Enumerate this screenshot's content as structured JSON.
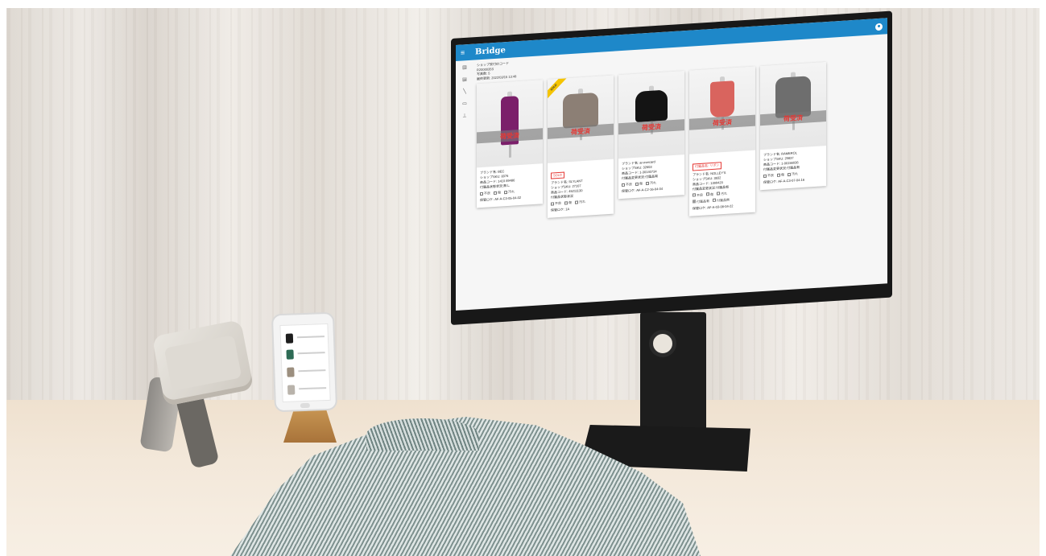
{
  "app": {
    "title": "Bridge",
    "header_color": "#1e88c9",
    "nav_icons": [
      "chart-icon",
      "store-icon",
      "tag-icon",
      "truck-icon",
      "pin-icon"
    ]
  },
  "info": {
    "line1": "ショップ受付IDコード",
    "line2": "R2000035S",
    "line3": "写真数: 5",
    "line4": "最終更新: 2022/03/15 13:48"
  },
  "cards": [
    {
      "image_color": "#7b1f6a",
      "status": "荷受済",
      "sold": false,
      "brand": "ブランド名: BEC",
      "shop_sku": "ショップSKU: 8376",
      "product_code": "商品コード: 1410 89486",
      "note": "付属品状態状況:無し",
      "checks": [
        "不良",
        "傷",
        "汚れ"
      ],
      "checks_on": [
        false,
        false,
        false
      ],
      "extra_checks": [],
      "location": "保管ロケ: AF-A-C3-05-04-02"
    },
    {
      "image_color": "#8c7f75",
      "status": "荷受済",
      "sold": true,
      "ribbon": "SOLD",
      "tag": "SOLD",
      "brand": "ブランド名: SLYLANT",
      "shop_sku": "ショップSKU: 27107",
      "product_code": "商品コード: 45211130",
      "note": "付属品状態状況",
      "checks": [
        "不良",
        "傷",
        "汚れ"
      ],
      "checks_on": [
        false,
        false,
        false
      ],
      "extra_checks": [],
      "location": "保管ロケ: 1A"
    },
    {
      "image_color": "#141414",
      "status": "荷受済",
      "sold": false,
      "brand": "ブランド名: ar-mercard",
      "shop_sku": "ショップSKU: 32603",
      "product_code": "商品コード: 1-30140734",
      "note": "付属品変更状況:付属品有",
      "checks": [
        "不良",
        "傷",
        "汚れ"
      ],
      "checks_on": [
        false,
        false,
        false
      ],
      "extra_checks": [],
      "location": "保管ロケ: AF-A-C2-16-04-04"
    },
    {
      "image_color": "#d9645e",
      "status": "荷受済",
      "sold": false,
      "tag": "付属品名: リボン",
      "brand": "ブランド名: NOLLEY'S",
      "shop_sku": "ショップSKU: 3832",
      "product_code": "商品コード: 1399420",
      "note": "付属品変更状況:付属品有",
      "checks": [
        "不良",
        "傷",
        "汚れ"
      ],
      "checks_on": [
        false,
        false,
        false
      ],
      "extra_checks": [
        "付属品有",
        "付属品無"
      ],
      "extra_on": [
        true,
        false
      ],
      "location": "保管ロケ: AF-A-03-08-04-22"
    },
    {
      "image_color": "#6e6e6e",
      "status": "荷受済",
      "sold": false,
      "brand": "ブランド名: RAMEROL",
      "shop_sku": "ショップSKU: 29837",
      "product_code": "商品コード: 1-00156036",
      "note": "付属品変更状況:付属品有",
      "checks": [
        "不良",
        "傷",
        "汚れ"
      ],
      "checks_on": [
        false,
        false,
        false
      ],
      "extra_checks": [],
      "location": "保管ロケ: AF-A-C3-07-04-16"
    }
  ]
}
